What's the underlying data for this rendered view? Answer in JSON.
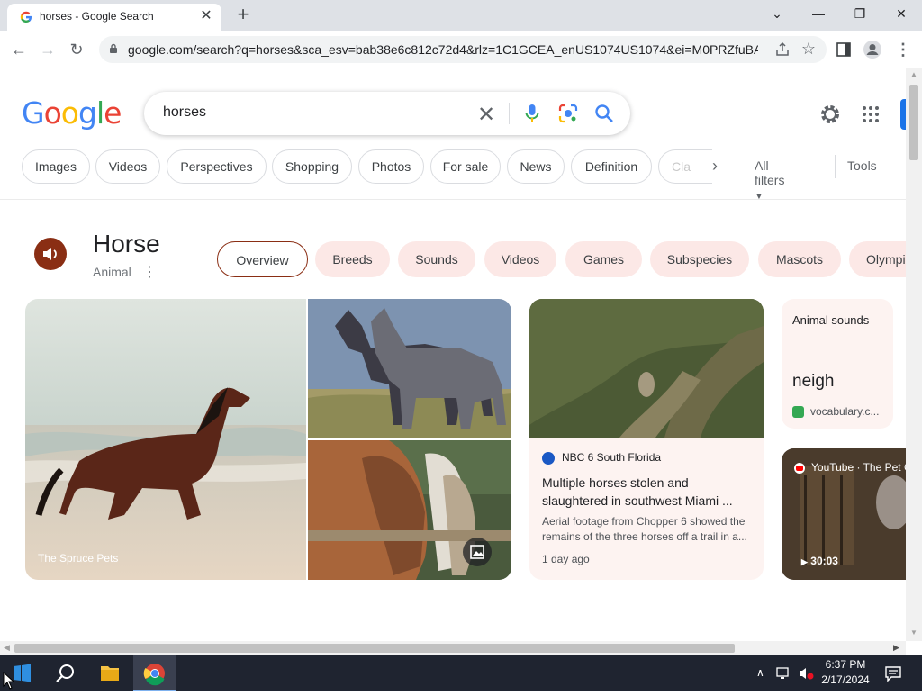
{
  "browser": {
    "tab_title": "horses - Google Search",
    "url": "google.com/search?q=horses&sca_esv=bab38e6c812c72d4&rlz=1C1GCEA_enUS1074US1074&ei=M0PRZfuBA9..."
  },
  "google": {
    "logo_text": [
      "G",
      "o",
      "o",
      "g",
      "l",
      "e"
    ],
    "logo_colors": [
      "#4285f4",
      "#ea4335",
      "#fbbc05",
      "#4285f4",
      "#34a853",
      "#ea4335"
    ],
    "query": "horses",
    "search_tabs": [
      "Images",
      "Videos",
      "Perspectives",
      "Shopping",
      "Photos",
      "For sale",
      "News",
      "Definition",
      "Cla"
    ],
    "all_filters": "All filters",
    "tools": "Tools"
  },
  "knowledge": {
    "title": "Horse",
    "subtitle": "Animal",
    "chips": [
      "Overview",
      "Breeds",
      "Sounds",
      "Videos",
      "Games",
      "Subspecies",
      "Mascots",
      "Olympi"
    ],
    "image_source": "The Spruce Pets",
    "news": {
      "source": "NBC 6 South Florida",
      "headline": "Multiple horses stolen and slaughtered in southwest Miami ...",
      "snippet": "Aerial footage from Chopper 6 showed the remains of the three horses off a trail in a...",
      "age": "1 day ago"
    },
    "sound_card": {
      "label": "Animal sounds",
      "word": "neigh",
      "source": "vocabulary.c..."
    },
    "video_card": {
      "source": "YouTube · The Pet C",
      "duration": "30:03"
    }
  },
  "taskbar": {
    "time": "6:37 PM",
    "date": "2/17/2024"
  }
}
